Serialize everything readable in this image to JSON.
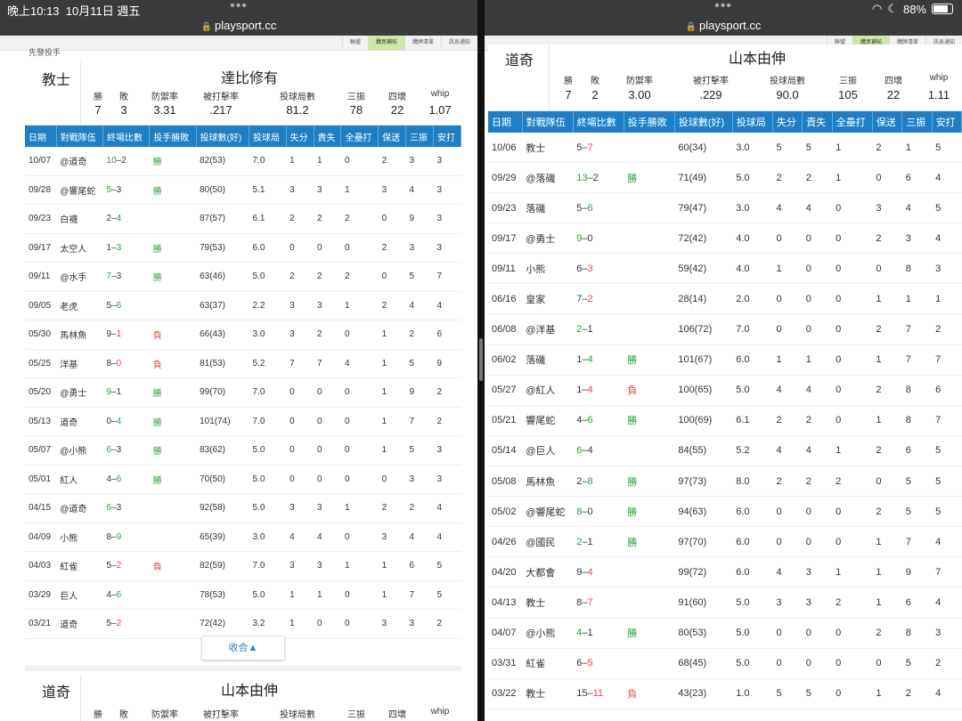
{
  "status": {
    "time": "晚上10:13",
    "date": "10月11日 週五",
    "battery": "88%",
    "wifi_icon": "wifi-icon",
    "moon_icon": "moon-icon"
  },
  "url": "playsport.cc",
  "sitebar": {
    "tab1": "聯盟",
    "tab2": "購買補帖",
    "tab3": "購牌清單",
    "tab4": "訊息通知"
  },
  "left": {
    "top_partial": "先發投手",
    "card1": {
      "team": "教士",
      "pitcher": "達比修有",
      "stat_labels": [
        "勝",
        "敗",
        "防禦率",
        "被打擊率",
        "投球局數",
        "三振",
        "四壞",
        "whip"
      ],
      "stat_values": [
        "7",
        "3",
        "3.31",
        ".217",
        "81.2",
        "78",
        "22",
        "1.07"
      ]
    },
    "headers": [
      "日期",
      "對戰隊伍",
      "終場比數",
      "投手勝敗",
      "投球數(好)",
      "投球局",
      "失分",
      "責失",
      "全壘打",
      "保送",
      "三振",
      "安打"
    ],
    "rows": [
      [
        "10/07",
        "@道奇",
        "10",
        "2",
        "勝",
        "82(53)",
        "7.0",
        "1",
        "1",
        "0",
        "2",
        "3",
        "3"
      ],
      [
        "09/28",
        "@響尾蛇",
        "5",
        "3",
        "勝",
        "80(50)",
        "5.1",
        "3",
        "3",
        "1",
        "3",
        "4",
        "3"
      ],
      [
        "09/23",
        "白襪",
        "2",
        "4",
        "",
        "87(57)",
        "6.1",
        "2",
        "2",
        "2",
        "0",
        "9",
        "3"
      ],
      [
        "09/17",
        "太空人",
        "1",
        "3",
        "勝",
        "79(53)",
        "6.0",
        "0",
        "0",
        "0",
        "2",
        "3",
        "3"
      ],
      [
        "09/11",
        "@水手",
        "7",
        "3",
        "勝",
        "63(46)",
        "5.0",
        "2",
        "2",
        "2",
        "0",
        "5",
        "7"
      ],
      [
        "09/05",
        "老虎",
        "5",
        "6",
        "",
        "63(37)",
        "2.2",
        "3",
        "3",
        "1",
        "2",
        "4",
        "4"
      ],
      [
        "05/30",
        "馬林魚",
        "9",
        "1",
        "負",
        "66(43)",
        "3.0",
        "3",
        "2",
        "0",
        "1",
        "2",
        "6"
      ],
      [
        "05/25",
        "洋基",
        "8",
        "0",
        "負",
        "81(53)",
        "5.2",
        "7",
        "7",
        "4",
        "1",
        "5",
        "9"
      ],
      [
        "05/20",
        "@勇士",
        "9",
        "1",
        "勝",
        "99(70)",
        "7.0",
        "0",
        "0",
        "0",
        "1",
        "9",
        "2"
      ],
      [
        "05/13",
        "道奇",
        "0",
        "4",
        "勝",
        "101(74)",
        "7.0",
        "0",
        "0",
        "0",
        "1",
        "7",
        "2"
      ],
      [
        "05/07",
        "@小熊",
        "6",
        "3",
        "勝",
        "83(62)",
        "5.0",
        "0",
        "0",
        "0",
        "1",
        "5",
        "3"
      ],
      [
        "05/01",
        "紅人",
        "4",
        "6",
        "勝",
        "70(50)",
        "5.0",
        "0",
        "0",
        "0",
        "0",
        "3",
        "3"
      ],
      [
        "04/15",
        "@道奇",
        "6",
        "3",
        "",
        "92(58)",
        "5.0",
        "3",
        "3",
        "1",
        "2",
        "2",
        "4"
      ],
      [
        "04/09",
        "小熊",
        "8",
        "9",
        "",
        "65(39)",
        "3.0",
        "4",
        "4",
        "0",
        "3",
        "4",
        "4"
      ],
      [
        "04/03",
        "紅雀",
        "5",
        "2",
        "負",
        "82(59)",
        "7.0",
        "3",
        "3",
        "1",
        "1",
        "6",
        "5"
      ],
      [
        "03/29",
        "巨人",
        "4",
        "6",
        "",
        "78(53)",
        "5.0",
        "1",
        "1",
        "0",
        "1",
        "7",
        "5"
      ],
      [
        "03/21",
        "道奇",
        "5",
        "2",
        "",
        "72(42)",
        "3.2",
        "1",
        "0",
        "0",
        "3",
        "3",
        "2"
      ]
    ],
    "left_colors": [
      "g",
      "g",
      "",
      "",
      "g",
      "",
      "r",
      "",
      "g",
      "",
      "g",
      "",
      "g",
      "",
      "",
      "r",
      "",
      ""
    ],
    "collapse": "收合▲",
    "card2": {
      "team": "道奇",
      "pitcher": "山本由伸",
      "stat_labels": [
        "勝",
        "敗",
        "防禦率",
        "被打擊率",
        "投球局數",
        "三振",
        "四壞",
        "whip"
      ]
    }
  },
  "right": {
    "card": {
      "team": "道奇",
      "pitcher": "山本由伸",
      "stat_labels": [
        "勝",
        "敗",
        "防禦率",
        "被打擊率",
        "投球局數",
        "三振",
        "四壞",
        "whip"
      ],
      "stat_values": [
        "7",
        "2",
        "3.00",
        ".229",
        "90.0",
        "105",
        "22",
        "1.11"
      ]
    },
    "headers": [
      "日期",
      "對戰隊伍",
      "終場比數",
      "投手勝敗",
      "投球數(好)",
      "投球局",
      "失分",
      "責失",
      "全壘打",
      "保送",
      "三振",
      "安打"
    ],
    "rows": [
      [
        "10/06",
        "教士",
        "5",
        "7",
        "",
        "60(34)",
        "3.0",
        "5",
        "5",
        "1",
        "2",
        "1",
        "5"
      ],
      [
        "09/29",
        "@落磯",
        "13",
        "2",
        "勝",
        "71(49)",
        "5.0",
        "2",
        "2",
        "1",
        "0",
        "6",
        "4"
      ],
      [
        "09/23",
        "落磯",
        "5",
        "6",
        "",
        "79(47)",
        "3.0",
        "4",
        "4",
        "0",
        "3",
        "4",
        "5"
      ],
      [
        "09/17",
        "@勇士",
        "9",
        "0",
        "",
        "72(42)",
        "4.0",
        "0",
        "0",
        "0",
        "2",
        "3",
        "4"
      ],
      [
        "09/11",
        "小熊",
        "6",
        "3",
        "",
        "59(42)",
        "4.0",
        "1",
        "0",
        "0",
        "0",
        "8",
        "3"
      ],
      [
        "06/16",
        "皇家",
        "7",
        "2",
        "",
        "28(14)",
        "2.0",
        "0",
        "0",
        "0",
        "1",
        "1",
        "1"
      ],
      [
        "06/08",
        "@洋基",
        "2",
        "1",
        "",
        "106(72)",
        "7.0",
        "0",
        "0",
        "0",
        "2",
        "7",
        "2"
      ],
      [
        "06/02",
        "落磯",
        "1",
        "4",
        "勝",
        "101(67)",
        "6.0",
        "1",
        "1",
        "0",
        "1",
        "7",
        "7"
      ],
      [
        "05/27",
        "@紅人",
        "1",
        "4",
        "負",
        "100(65)",
        "5.0",
        "4",
        "4",
        "0",
        "2",
        "8",
        "6"
      ],
      [
        "05/21",
        "響尾蛇",
        "4",
        "6",
        "勝",
        "100(69)",
        "6.1",
        "2",
        "2",
        "0",
        "1",
        "8",
        "7"
      ],
      [
        "05/14",
        "@巨人",
        "6",
        "4",
        "",
        "84(55)",
        "5.2",
        "4",
        "4",
        "1",
        "2",
        "6",
        "5"
      ],
      [
        "05/08",
        "馬林魚",
        "2",
        "8",
        "勝",
        "97(73)",
        "8.0",
        "2",
        "2",
        "2",
        "0",
        "5",
        "5"
      ],
      [
        "05/02",
        "@響尾蛇",
        "8",
        "0",
        "勝",
        "94(63)",
        "6.0",
        "0",
        "0",
        "0",
        "2",
        "5",
        "5"
      ],
      [
        "04/26",
        "@國民",
        "2",
        "1",
        "勝",
        "97(70)",
        "6.0",
        "0",
        "0",
        "0",
        "1",
        "7",
        "4"
      ],
      [
        "04/20",
        "大都會",
        "9",
        "4",
        "",
        "99(72)",
        "6.0",
        "4",
        "3",
        "1",
        "1",
        "9",
        "7"
      ],
      [
        "04/13",
        "教士",
        "8",
        "7",
        "",
        "91(60)",
        "5.0",
        "3",
        "3",
        "2",
        "1",
        "6",
        "4"
      ],
      [
        "04/07",
        "@小熊",
        "4",
        "1",
        "勝",
        "80(53)",
        "5.0",
        "0",
        "0",
        "0",
        "2",
        "8",
        "3"
      ],
      [
        "03/31",
        "紅雀",
        "6",
        "5",
        "",
        "68(45)",
        "5.0",
        "0",
        "0",
        "0",
        "0",
        "5",
        "2"
      ],
      [
        "03/22",
        "教士",
        "15",
        "11",
        "負",
        "43(23)",
        "1.0",
        "5",
        "5",
        "0",
        "1",
        "2",
        "4"
      ]
    ]
  }
}
